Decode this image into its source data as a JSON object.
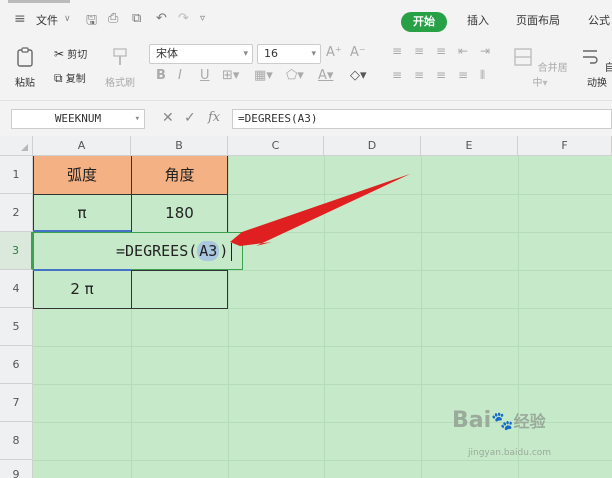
{
  "menu": {
    "file_label": "文件",
    "tabs": [
      "开始",
      "插入",
      "页面布局",
      "公式"
    ]
  },
  "ribbon": {
    "paste_label": "粘贴",
    "cut_label": "剪切",
    "copy_label": "复制",
    "format_painter_label": "格式刷",
    "font_name": "宋体",
    "font_size": "16",
    "merge_label": "合并居中",
    "wrap_label": "自动换"
  },
  "formula_bar": {
    "name_box": "WEEKNUM",
    "fx_label": "fx",
    "formula": "=DEGREES(A3)"
  },
  "grid": {
    "columns": [
      "A",
      "B",
      "C",
      "D",
      "E",
      "F"
    ],
    "rows": [
      "1",
      "2",
      "3",
      "4",
      "5",
      "6",
      "7",
      "8",
      "9"
    ],
    "cells": {
      "A1": "弧度",
      "B1": "角度",
      "A2": "π",
      "B2": "180",
      "A4": "2 π"
    },
    "edit_formula_prefix": "=DEGREES(",
    "edit_formula_ref": "A3",
    "edit_formula_suffix": ")"
  },
  "watermark": {
    "brand": "Bai",
    "brand_suffix": "经验",
    "url": "jingyan.baidu.com"
  },
  "colors": {
    "header_fill": "#f4b183",
    "sheet_background": "#c6eac9",
    "accent_green": "#27a046",
    "arrow_red": "#e02020"
  }
}
